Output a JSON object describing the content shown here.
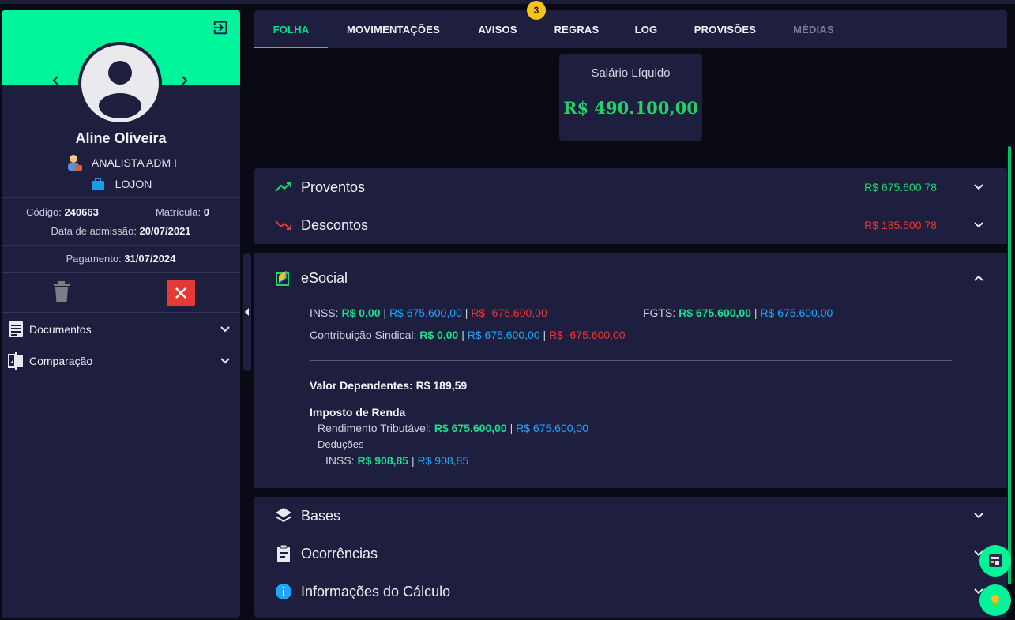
{
  "employee": {
    "name": "Aline Oliveira",
    "role": "ANALISTA ADM I",
    "company": "LOJON",
    "code_label": "Código:",
    "code": "240663",
    "registration_label": "Matrícula:",
    "registration": "0",
    "admission_label": "Data de admissão:",
    "admission": "20/07/2021",
    "payment_label": "Pagamento:",
    "payment": "31/07/2024"
  },
  "sidebar_menu": [
    {
      "label": "Documentos",
      "icon": "document-list-icon"
    },
    {
      "label": "Comparação",
      "icon": "compare-icon"
    }
  ],
  "tabs": [
    {
      "label": "FOLHA",
      "state": "active"
    },
    {
      "label": "MOVIMENTAÇÕES",
      "state": "normal"
    },
    {
      "label": "AVISOS",
      "state": "normal",
      "badge": "3"
    },
    {
      "label": "REGRAS",
      "state": "normal"
    },
    {
      "label": "LOG",
      "state": "normal"
    },
    {
      "label": "PROVISÕES",
      "state": "normal"
    },
    {
      "label": "MÉDIAS",
      "state": "disabled"
    }
  ],
  "net_salary": {
    "label": "Salário Líquido",
    "value": "R$ 490.100,00"
  },
  "sections": {
    "proventos": {
      "title": "Proventos",
      "value": "R$ 675.600,78"
    },
    "descontos": {
      "title": "Descontos",
      "value": "R$ 185.500,78"
    },
    "esocial": {
      "title": "eSocial",
      "inss_label": "INSS:",
      "inss_a": "R$ 0,00",
      "inss_b": "R$ 675.600,00",
      "inss_c": "R$ -675.600,00",
      "fgts_label": "FGTS:",
      "fgts_a": "R$ 675.600,00",
      "fgts_b": "R$ 675.600,00",
      "sind_label": "Contribuição Sindical:",
      "sind_a": "R$ 0,00",
      "sind_b": "R$ 675.600,00",
      "sind_c": "R$ -675.600,00",
      "dependentes": "Valor Dependentes: R$ 189,59",
      "ir_title": "Imposto de Renda",
      "rend_label": "Rendimento Tributável:",
      "rend_a": "R$ 675.600,00",
      "rend_b": "R$ 675.600,00",
      "deducoes_label": "Deduções",
      "ded_inss_label": "INSS:",
      "ded_inss_a": "R$ 908,85",
      "ded_inss_b": "R$ 908,85"
    },
    "bases": {
      "title": "Bases"
    },
    "ocorrencias": {
      "title": "Ocorrências"
    },
    "info_calc": {
      "title": "Informações do Cálculo"
    }
  },
  "separator": "|",
  "colors": {
    "accent": "#00f59a",
    "positive": "#19e08b",
    "info": "#1ea7ff",
    "negative": "#e53935",
    "panel": "#1e1e3f",
    "background": "#0a0a14"
  }
}
